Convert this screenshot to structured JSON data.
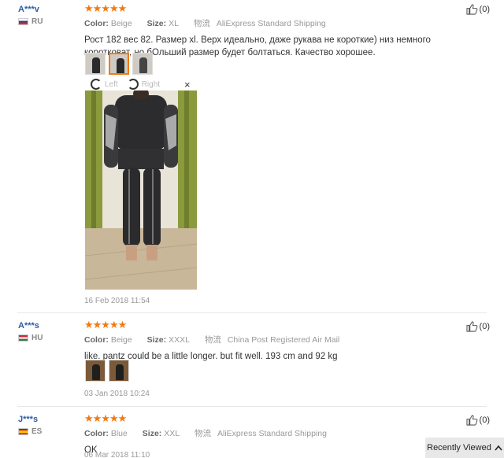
{
  "reviews": [
    {
      "user": "A***v",
      "country": "RU",
      "stars": "★★★★★",
      "color_label": "Color:",
      "color": "Beige",
      "size_label": "Size:",
      "size": "XL",
      "ship_label": "物流",
      "shipping": "AliExpress Standard Shipping",
      "text": "Рост 182 вес 82. Размер xl. Верх идеально, даже рукава не короткие) низ немного коротковат, но бОльший размер будет болтаться. Качество хорошее.",
      "helpful": "(0)",
      "left_label": "Left",
      "right_label": "Right",
      "close": "×",
      "date": "16 Feb 2018 11:54"
    },
    {
      "user": "A***s",
      "country": "HU",
      "stars": "★★★★★",
      "color_label": "Color:",
      "color": "Beige",
      "size_label": "Size:",
      "size": "XXXL",
      "ship_label": "物流",
      "shipping": "China Post Registered Air Mail",
      "text": "like. pantz could be a little longer. but fit well. 193 cm and 92 kg",
      "helpful": "(0)",
      "date": "03 Jan 2018 10:24"
    },
    {
      "user": "J***s",
      "country": "ES",
      "stars": "★★★★★",
      "color_label": "Color:",
      "color": "Blue",
      "size_label": "Size:",
      "size": "XXL",
      "ship_label": "物流",
      "shipping": "AliExpress Standard Shipping",
      "text": "OK",
      "helpful": "(0)",
      "date": "06 Mar 2018 11:10"
    }
  ],
  "recently_viewed": {
    "label": "Recently Viewed",
    "icon": "chevron-up-icon"
  },
  "colors": {
    "star": "#f27a10",
    "user": "#2a5ca8"
  }
}
